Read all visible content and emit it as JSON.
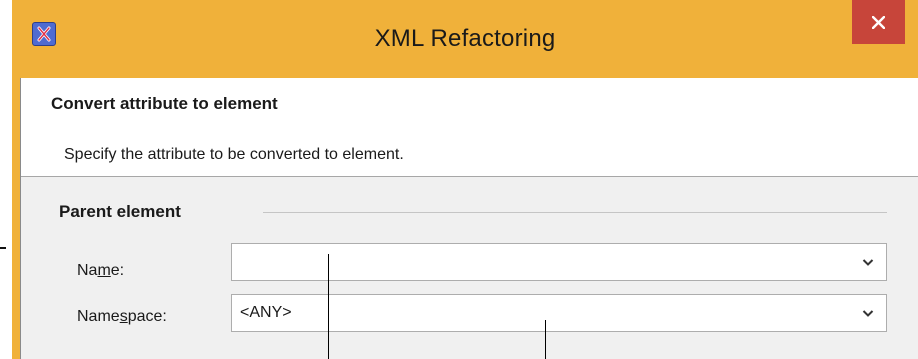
{
  "window": {
    "title": "XML Refactoring"
  },
  "icons": {
    "app": "xml-refactoring-app-icon",
    "close": "close-icon",
    "dropdown": "chevron-down-icon"
  },
  "banner": {
    "title": "Convert attribute to element",
    "description": "Specify the attribute to be converted to element."
  },
  "parent_element": {
    "group_label": "Parent element",
    "name": {
      "label_before": "Na",
      "label_mnemonic": "m",
      "label_after": "e:",
      "value": ""
    },
    "namespace": {
      "label_before": "Name",
      "label_mnemonic": "s",
      "label_after": "pace:",
      "value": "<ANY>"
    }
  },
  "colors": {
    "titlebar": "#f0b13a",
    "close_button": "#c7453a",
    "dialog_background": "#f0f0f0",
    "banner_background": "#ffffff"
  }
}
